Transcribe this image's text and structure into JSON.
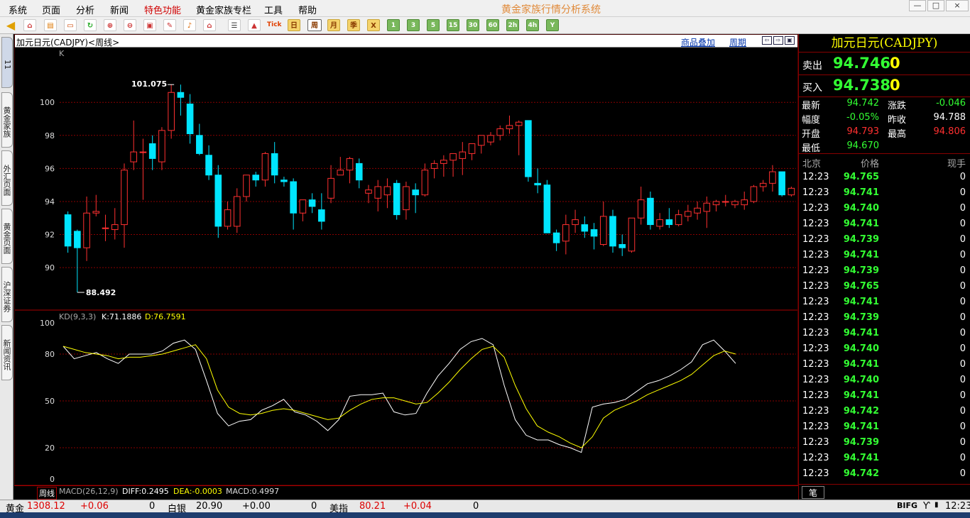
{
  "menu": [
    "系统",
    "页面",
    "分析",
    "新闻",
    "特色功能",
    "黄金家族专栏",
    "工具",
    "帮助"
  ],
  "highlight_menu_color": "#d00000",
  "app_title": "黄金家族行情分析系统",
  "window_controls": {
    "minimize": "—",
    "maximize": "□",
    "close": "×"
  },
  "toolbar": {
    "icons": [
      "back-icon",
      "home-icon",
      "folder-icon",
      "refresh-icon",
      "zoom-in-icon",
      "zoom-out-icon",
      "window-icon",
      "pen-icon",
      "bell-icon",
      "house-icon",
      "list-icon",
      "chart-icon"
    ],
    "tick_label": "Tick",
    "periods": [
      "日",
      "周",
      "月",
      "季",
      "X"
    ],
    "active_period": "周",
    "minutes": [
      "1",
      "3",
      "5",
      "15",
      "30",
      "60",
      "2h",
      "4h",
      "Y"
    ]
  },
  "left_tabs": [
    "11",
    "黄金家族",
    "外汇页面",
    "黄金页面",
    "沪深证券",
    "新闻资讯"
  ],
  "chart_header": {
    "name": "加元日元(CADJPY)<周线>",
    "overlay_link": "商品叠加",
    "period_link": "周期"
  },
  "chart_data": {
    "type": "candlestick",
    "series_label": "K",
    "y_ticks": [
      100,
      98,
      96,
      94,
      92,
      90
    ],
    "ylim": [
      87.6,
      102.2
    ],
    "high_label": "101.075",
    "low_label": "88.492",
    "candles": [
      {
        "o": 93.2,
        "h": 93.4,
        "l": 90.9,
        "c": 91.3
      },
      {
        "o": 92.2,
        "h": 92.3,
        "l": 88.5,
        "c": 91.2
      },
      {
        "o": 91.2,
        "h": 94.3,
        "l": 90.4,
        "c": 93.3
      },
      {
        "o": 93.3,
        "h": 94.4,
        "l": 93.1,
        "c": 93.4
      },
      {
        "o": 92.4,
        "h": 93.2,
        "l": 91.6,
        "c": 92.4
      },
      {
        "o": 92.3,
        "h": 93.6,
        "l": 91.7,
        "c": 92.6
      },
      {
        "o": 92.6,
        "h": 96.3,
        "l": 91.2,
        "c": 95.9
      },
      {
        "o": 96.4,
        "h": 98.9,
        "l": 95.9,
        "c": 97.0
      },
      {
        "o": 97.0,
        "h": 97.8,
        "l": 94.1,
        "c": 97.0
      },
      {
        "o": 97.5,
        "h": 98.0,
        "l": 95.9,
        "c": 96.6
      },
      {
        "o": 96.4,
        "h": 98.5,
        "l": 95.9,
        "c": 98.3
      },
      {
        "o": 98.3,
        "h": 101.075,
        "l": 97.8,
        "c": 100.6
      },
      {
        "o": 100.6,
        "h": 101.075,
        "l": 99.2,
        "c": 100.3
      },
      {
        "o": 99.9,
        "h": 100.5,
        "l": 97.5,
        "c": 98.1
      },
      {
        "o": 98.0,
        "h": 98.7,
        "l": 96.8,
        "c": 96.9
      },
      {
        "o": 96.8,
        "h": 97.4,
        "l": 95.3,
        "c": 95.6
      },
      {
        "o": 95.6,
        "h": 96.2,
        "l": 91.8,
        "c": 92.5
      },
      {
        "o": 92.5,
        "h": 94.0,
        "l": 92.3,
        "c": 93.5
      },
      {
        "o": 92.5,
        "h": 94.8,
        "l": 92.1,
        "c": 94.3
      },
      {
        "o": 94.3,
        "h": 95.6,
        "l": 94.0,
        "c": 95.6
      },
      {
        "o": 95.6,
        "h": 95.8,
        "l": 94.9,
        "c": 95.3
      },
      {
        "o": 95.3,
        "h": 97.0,
        "l": 94.9,
        "c": 96.9
      },
      {
        "o": 96.9,
        "h": 97.6,
        "l": 95.1,
        "c": 95.6
      },
      {
        "o": 95.3,
        "h": 95.5,
        "l": 94.9,
        "c": 95.2
      },
      {
        "o": 95.2,
        "h": 95.4,
        "l": 92.3,
        "c": 93.3
      },
      {
        "o": 93.3,
        "h": 94.1,
        "l": 92.8,
        "c": 94.1
      },
      {
        "o": 94.1,
        "h": 94.5,
        "l": 93.3,
        "c": 93.7
      },
      {
        "o": 93.5,
        "h": 94.5,
        "l": 92.3,
        "c": 92.8
      },
      {
        "o": 94.2,
        "h": 96.2,
        "l": 93.9,
        "c": 95.4
      },
      {
        "o": 95.6,
        "h": 96.7,
        "l": 95.6,
        "c": 95.9
      },
      {
        "o": 95.9,
        "h": 96.7,
        "l": 95.1,
        "c": 96.6
      },
      {
        "o": 96.3,
        "h": 96.6,
        "l": 94.8,
        "c": 95.3
      },
      {
        "o": 94.5,
        "h": 95.0,
        "l": 93.9,
        "c": 94.7
      },
      {
        "o": 94.2,
        "h": 95.3,
        "l": 93.4,
        "c": 94.9
      },
      {
        "o": 94.4,
        "h": 95.4,
        "l": 93.6,
        "c": 94.9
      },
      {
        "o": 95.1,
        "h": 95.3,
        "l": 92.9,
        "c": 93.2
      },
      {
        "o": 93.5,
        "h": 95.2,
        "l": 92.9,
        "c": 94.9
      },
      {
        "o": 94.7,
        "h": 95.1,
        "l": 93.3,
        "c": 94.4
      },
      {
        "o": 94.4,
        "h": 96.3,
        "l": 94.3,
        "c": 95.9
      },
      {
        "o": 96.0,
        "h": 96.5,
        "l": 95.4,
        "c": 96.3
      },
      {
        "o": 96.3,
        "h": 96.8,
        "l": 95.5,
        "c": 96.5
      },
      {
        "o": 96.5,
        "h": 96.8,
        "l": 95.5,
        "c": 96.9
      },
      {
        "o": 96.6,
        "h": 97.6,
        "l": 95.6,
        "c": 97.0
      },
      {
        "o": 96.9,
        "h": 97.4,
        "l": 96.5,
        "c": 97.5
      },
      {
        "o": 97.4,
        "h": 97.9,
        "l": 96.9,
        "c": 98.0
      },
      {
        "o": 97.6,
        "h": 98.2,
        "l": 97.4,
        "c": 98.0
      },
      {
        "o": 98.0,
        "h": 98.6,
        "l": 97.7,
        "c": 98.4
      },
      {
        "o": 98.4,
        "h": 99.2,
        "l": 98.1,
        "c": 98.6
      },
      {
        "o": 98.6,
        "h": 98.9,
        "l": 96.8,
        "c": 98.8
      },
      {
        "o": 98.9,
        "h": 98.9,
        "l": 95.2,
        "c": 95.5
      },
      {
        "o": 95.1,
        "h": 96.0,
        "l": 94.5,
        "c": 95.0
      },
      {
        "o": 95.0,
        "h": 95.3,
        "l": 92.1,
        "c": 92.1
      },
      {
        "o": 92.1,
        "h": 92.3,
        "l": 91.0,
        "c": 91.5
      },
      {
        "o": 91.6,
        "h": 93.2,
        "l": 90.8,
        "c": 92.6
      },
      {
        "o": 92.6,
        "h": 93.5,
        "l": 92.1,
        "c": 92.9
      },
      {
        "o": 92.6,
        "h": 93.1,
        "l": 91.8,
        "c": 92.2
      },
      {
        "o": 92.3,
        "h": 92.7,
        "l": 91.1,
        "c": 91.9
      },
      {
        "o": 91.4,
        "h": 94.0,
        "l": 91.3,
        "c": 93.1
      },
      {
        "o": 93.1,
        "h": 93.5,
        "l": 90.9,
        "c": 91.3
      },
      {
        "o": 91.4,
        "h": 92.0,
        "l": 90.7,
        "c": 91.2
      },
      {
        "o": 91.0,
        "h": 93.0,
        "l": 90.9,
        "c": 93.0
      },
      {
        "o": 93.0,
        "h": 94.9,
        "l": 92.6,
        "c": 94.1
      },
      {
        "o": 94.2,
        "h": 94.6,
        "l": 92.3,
        "c": 92.6
      },
      {
        "o": 92.5,
        "h": 93.3,
        "l": 92.3,
        "c": 92.9
      },
      {
        "o": 92.9,
        "h": 93.6,
        "l": 92.4,
        "c": 92.6
      },
      {
        "o": 92.6,
        "h": 93.5,
        "l": 92.5,
        "c": 93.2
      },
      {
        "o": 93.1,
        "h": 93.8,
        "l": 92.8,
        "c": 93.4
      },
      {
        "o": 93.3,
        "h": 94.0,
        "l": 92.9,
        "c": 93.6
      },
      {
        "o": 93.4,
        "h": 94.3,
        "l": 92.4,
        "c": 93.9
      },
      {
        "o": 93.8,
        "h": 94.1,
        "l": 93.4,
        "c": 94.0
      },
      {
        "o": 94.0,
        "h": 94.4,
        "l": 93.7,
        "c": 94.0
      },
      {
        "o": 93.8,
        "h": 94.1,
        "l": 93.6,
        "c": 94.0
      },
      {
        "o": 93.8,
        "h": 94.6,
        "l": 93.5,
        "c": 94.1
      },
      {
        "o": 94.0,
        "h": 95.0,
        "l": 93.9,
        "c": 94.9
      },
      {
        "o": 94.9,
        "h": 95.3,
        "l": 94.6,
        "c": 95.1
      },
      {
        "o": 95.1,
        "h": 96.2,
        "l": 94.6,
        "c": 95.8
      },
      {
        "o": 95.8,
        "h": 95.8,
        "l": 94.3,
        "c": 94.4
      },
      {
        "o": 94.4,
        "h": 94.9,
        "l": 94.3,
        "c": 94.8
      }
    ],
    "up_color": "#ff3030",
    "down_color": "#00e5ff",
    "kd": {
      "label": "KD(9,3,3)",
      "k_label": "K:71.1886",
      "d_label": "D:76.7591",
      "y_ticks": [
        100,
        80,
        50,
        20,
        0
      ],
      "k_color": "#ffffff",
      "d_color": "#ffff00",
      "k": [
        85,
        77,
        79,
        81,
        77,
        74,
        80,
        80,
        80,
        82,
        87,
        89,
        83,
        63,
        42,
        34,
        37,
        38,
        44,
        47,
        51,
        43,
        41,
        37,
        31,
        38,
        53,
        54,
        54,
        55,
        43,
        41,
        42,
        55,
        66,
        74,
        83,
        88,
        90,
        86,
        60,
        38,
        28,
        25,
        25,
        22,
        20,
        17,
        46,
        48,
        49,
        51,
        56,
        61,
        63,
        66,
        70,
        75,
        86,
        89,
        82,
        74
      ],
      "d": [
        85,
        83,
        81,
        80,
        79,
        77,
        78,
        78,
        79,
        80,
        82,
        84,
        86,
        77,
        57,
        46,
        42,
        41,
        42,
        44,
        45,
        44,
        42,
        40,
        38,
        39,
        44,
        48,
        51,
        52,
        52,
        50,
        48,
        49,
        55,
        62,
        70,
        77,
        83,
        85,
        78,
        60,
        45,
        34,
        30,
        27,
        23,
        20,
        27,
        39,
        44,
        47,
        50,
        54,
        57,
        60,
        63,
        67,
        73,
        79,
        82,
        80
      ]
    },
    "macd_label": "MACD(26,12,9)",
    "diff_label": "DIFF:0.2495",
    "dea_label": "DEA:-0.0003",
    "macd_value_label": "MACD:0.4997"
  },
  "period_tab": "周线",
  "quote": {
    "title": "加元日元(CADJPY)",
    "sell_label": "卖出",
    "sell_price": "94.746",
    "sell_vol": "0",
    "buy_label": "买入",
    "buy_price": "94.738",
    "buy_vol": "0",
    "stats": [
      {
        "label": "最新",
        "value": "94.742",
        "color": "#33ff33"
      },
      {
        "label": "涨跌",
        "value": "-0.046",
        "color": "#33ff33"
      },
      {
        "label": "幅度",
        "value": "-0.05%",
        "color": "#33ff33"
      },
      {
        "label": "昨收",
        "value": "94.788",
        "color": "#ffffff"
      },
      {
        "label": "开盘",
        "value": "94.793",
        "color": "#ff3030"
      },
      {
        "label": "最高",
        "value": "94.806",
        "color": "#ff3030"
      },
      {
        "label": "最低",
        "value": "94.670",
        "color": "#33ff33"
      }
    ],
    "tick_header": {
      "time": "北京",
      "price": "价格",
      "vol": "现手"
    },
    "ticks": [
      {
        "t": "12:23",
        "p": "94.765",
        "v": "0"
      },
      {
        "t": "12:23",
        "p": "94.741",
        "v": "0"
      },
      {
        "t": "12:23",
        "p": "94.740",
        "v": "0"
      },
      {
        "t": "12:23",
        "p": "94.741",
        "v": "0"
      },
      {
        "t": "12:23",
        "p": "94.739",
        "v": "0"
      },
      {
        "t": "12:23",
        "p": "94.741",
        "v": "0"
      },
      {
        "t": "12:23",
        "p": "94.739",
        "v": "0"
      },
      {
        "t": "12:23",
        "p": "94.765",
        "v": "0"
      },
      {
        "t": "12:23",
        "p": "94.741",
        "v": "0"
      },
      {
        "t": "12:23",
        "p": "94.739",
        "v": "0"
      },
      {
        "t": "12:23",
        "p": "94.741",
        "v": "0"
      },
      {
        "t": "12:23",
        "p": "94.740",
        "v": "0"
      },
      {
        "t": "12:23",
        "p": "94.741",
        "v": "0"
      },
      {
        "t": "12:23",
        "p": "94.740",
        "v": "0"
      },
      {
        "t": "12:23",
        "p": "94.741",
        "v": "0"
      },
      {
        "t": "12:23",
        "p": "94.742",
        "v": "0"
      },
      {
        "t": "12:23",
        "p": "94.741",
        "v": "0"
      },
      {
        "t": "12:23",
        "p": "94.739",
        "v": "0"
      },
      {
        "t": "12:23",
        "p": "94.741",
        "v": "0"
      },
      {
        "t": "12:23",
        "p": "94.742",
        "v": "0"
      }
    ],
    "tab": "笔"
  },
  "status": {
    "gold_label": "黄金",
    "gold_price": "1308.12",
    "gold_chg": "+0.06",
    "gold_vol": "0",
    "silver_label": "白银",
    "silver_price": "20.90",
    "silver_chg": "+0.00",
    "silver_vol": "0",
    "usd_label": "美指",
    "usd_price": "80.21",
    "usd_chg": "+0.04",
    "usd_vol": "0",
    "brand": "BIFG",
    "clock": "12:23"
  }
}
